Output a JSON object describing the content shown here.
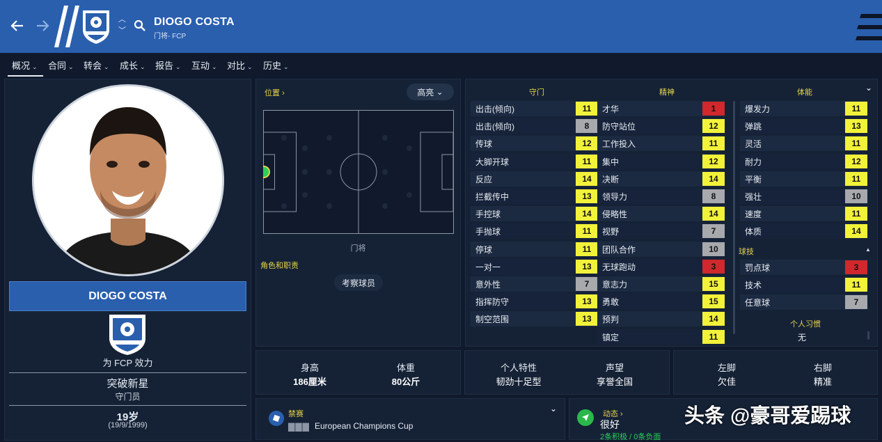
{
  "header": {
    "player_name": "DIOGO COSTA",
    "subtitle": "门将- FCP",
    "back_icon": "arrow-left-icon",
    "forward_icon": "arrow-right-icon",
    "search_icon": "search-icon"
  },
  "tabs": [
    {
      "label": "概况",
      "active": true
    },
    {
      "label": "合同"
    },
    {
      "label": "转会"
    },
    {
      "label": "成长"
    },
    {
      "label": "报告"
    },
    {
      "label": "互动"
    },
    {
      "label": "对比"
    },
    {
      "label": "历史"
    }
  ],
  "profile": {
    "name": "DIOGO COSTA",
    "club_line": "为 FCP 效力",
    "tag": "突破新星",
    "role": "守门员",
    "age": "19岁",
    "birth": "(19/9/1999)"
  },
  "position": {
    "title": "位置",
    "highlight_label": "高亮",
    "pitch_label": "门将",
    "roles_label": "角色和职责",
    "scout_button": "考察球员"
  },
  "attributes": {
    "goalkeeping": {
      "title": "守门",
      "items": [
        {
          "name": "出击(倾向)",
          "value": "11",
          "tier": "yel"
        },
        {
          "name": "出击(倾向)",
          "value": "8",
          "tier": "gry"
        },
        {
          "name": "传球",
          "value": "12",
          "tier": "yel"
        },
        {
          "name": "大脚开球",
          "value": "11",
          "tier": "yel"
        },
        {
          "name": "反应",
          "value": "14",
          "tier": "yel"
        },
        {
          "name": "拦截传中",
          "value": "13",
          "tier": "yel"
        },
        {
          "name": "手控球",
          "value": "14",
          "tier": "yel"
        },
        {
          "name": "手抛球",
          "value": "11",
          "tier": "yel"
        },
        {
          "name": "停球",
          "value": "11",
          "tier": "yel"
        },
        {
          "name": "一对一",
          "value": "13",
          "tier": "yel"
        },
        {
          "name": "意外性",
          "value": "7",
          "tier": "gry"
        },
        {
          "name": "指挥防守",
          "value": "13",
          "tier": "yel"
        },
        {
          "name": "制空范围",
          "value": "13",
          "tier": "yel"
        }
      ]
    },
    "mental": {
      "title": "精神",
      "items": [
        {
          "name": "才华",
          "value": "1",
          "tier": "red"
        },
        {
          "name": "防守站位",
          "value": "12",
          "tier": "yel"
        },
        {
          "name": "工作投入",
          "value": "11",
          "tier": "yel"
        },
        {
          "name": "集中",
          "value": "12",
          "tier": "yel"
        },
        {
          "name": "决断",
          "value": "14",
          "tier": "yel"
        },
        {
          "name": "领导力",
          "value": "8",
          "tier": "gry"
        },
        {
          "name": "侵略性",
          "value": "14",
          "tier": "yel"
        },
        {
          "name": "视野",
          "value": "7",
          "tier": "gry"
        },
        {
          "name": "团队合作",
          "value": "10",
          "tier": "gry"
        },
        {
          "name": "无球跑动",
          "value": "3",
          "tier": "red"
        },
        {
          "name": "意志力",
          "value": "15",
          "tier": "yel"
        },
        {
          "name": "勇敢",
          "value": "15",
          "tier": "yel"
        },
        {
          "name": "预判",
          "value": "14",
          "tier": "yel"
        },
        {
          "name": "镇定",
          "value": "11",
          "tier": "yel"
        }
      ]
    },
    "physical": {
      "title": "体能",
      "items": [
        {
          "name": "爆发力",
          "value": "11",
          "tier": "yel"
        },
        {
          "name": "弹跳",
          "value": "13",
          "tier": "yel"
        },
        {
          "name": "灵活",
          "value": "11",
          "tier": "yel"
        },
        {
          "name": "耐力",
          "value": "12",
          "tier": "yel"
        },
        {
          "name": "平衡",
          "value": "11",
          "tier": "yel"
        },
        {
          "name": "强壮",
          "value": "10",
          "tier": "gry"
        },
        {
          "name": "速度",
          "value": "11",
          "tier": "yel"
        },
        {
          "name": "体质",
          "value": "14",
          "tier": "yel"
        }
      ]
    },
    "technique": {
      "title": "球技",
      "items": [
        {
          "name": "罚点球",
          "value": "3",
          "tier": "red"
        },
        {
          "name": "技术",
          "value": "11",
          "tier": "yel"
        },
        {
          "name": "任意球",
          "value": "7",
          "tier": "gry"
        }
      ]
    },
    "habits_title": "个人习惯",
    "habits_value": "无"
  },
  "stats": {
    "height_label": "身高",
    "height_value": "186厘米",
    "weight_label": "体重",
    "weight_value": "80公斤",
    "trait_label": "个人特性",
    "trait_value": "韧劲十足型",
    "rep_label": "声望",
    "rep_value": "享誉全国",
    "left_foot_label": "左脚",
    "left_foot_value": "欠佳",
    "right_foot_label": "右脚",
    "right_foot_value": "精准"
  },
  "bottom": {
    "ban_title": "禁赛",
    "ban_comp": "European Champions Cup",
    "status_title": "动态",
    "status_value": "很好",
    "status_sub": "2条积极 / 0条负面"
  },
  "watermark": "头条 @豪哥爱踢球"
}
